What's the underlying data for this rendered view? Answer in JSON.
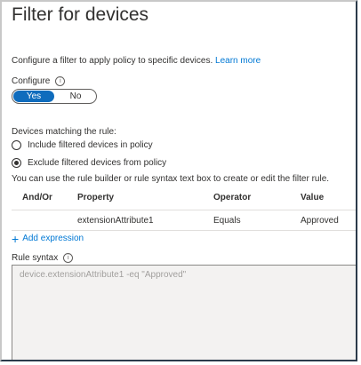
{
  "title": "Filter for devices",
  "description": "Configure a filter to apply policy to specific devices.",
  "learn_more": "Learn more",
  "configure": {
    "label": "Configure",
    "info_icon": "info-icon",
    "options": [
      "Yes",
      "No"
    ],
    "selected": "Yes"
  },
  "matching": {
    "label": "Devices matching the rule:",
    "options": [
      {
        "label": "Include filtered devices in policy",
        "checked": false
      },
      {
        "label": "Exclude filtered devices from policy",
        "checked": true
      }
    ]
  },
  "hint": "You can use the rule builder or rule syntax text box to create or edit the filter rule.",
  "table": {
    "headers": [
      "And/Or",
      "Property",
      "Operator",
      "Value"
    ],
    "rows": [
      [
        "",
        "extensionAttribute1",
        "Equals",
        "Approved"
      ]
    ]
  },
  "add_expression": "Add expression",
  "rule_syntax": {
    "label": "Rule syntax",
    "value": "device.extensionAttribute1 -eq \"Approved\""
  },
  "colors": {
    "accent": "#0f6cbd",
    "link": "#0078d4"
  }
}
